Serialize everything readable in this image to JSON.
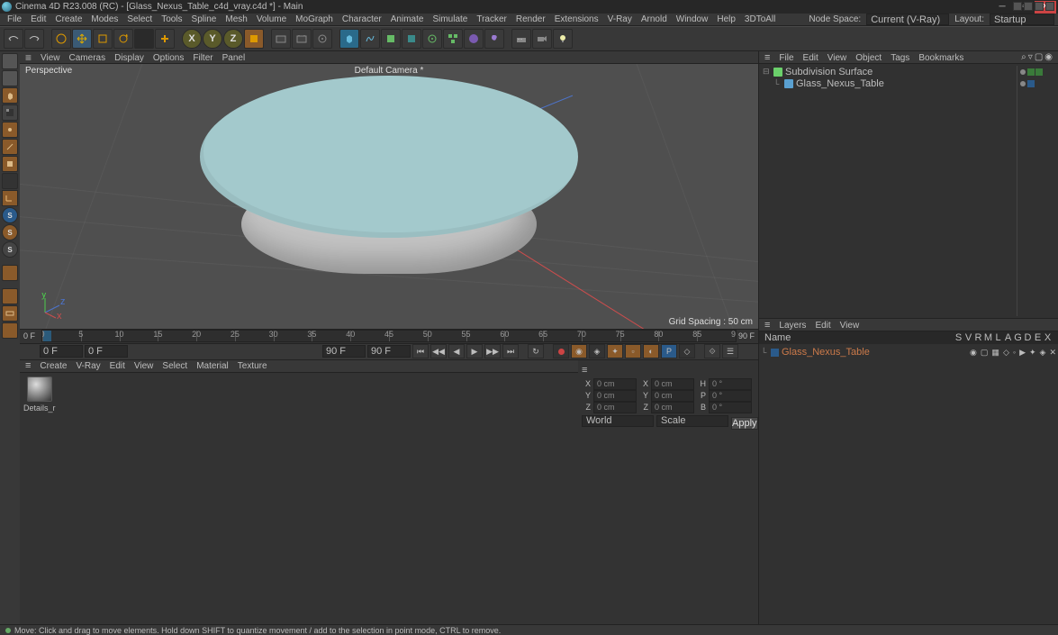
{
  "title": "Cinema 4D R23.008 (RC) - [Glass_Nexus_Table_c4d_vray.c4d *] - Main",
  "menubar": [
    "File",
    "Edit",
    "Create",
    "Modes",
    "Select",
    "Tools",
    "Spline",
    "Mesh",
    "Volume",
    "MoGraph",
    "Character",
    "Animate",
    "Simulate",
    "Tracker",
    "Render",
    "Extensions",
    "V-Ray",
    "Arnold",
    "Window",
    "Help",
    "3DToAll"
  ],
  "nodespace_lbl": "Node Space:",
  "nodespace_val": "Current (V-Ray)",
  "layout_lbl": "Layout:",
  "layout_val": "Startup",
  "view_menus": [
    "View",
    "Cameras",
    "Display",
    "Options",
    "Filter",
    "Panel"
  ],
  "viewport": {
    "name": "Perspective",
    "camera": "Default Camera *",
    "grid": "Grid Spacing : 50 cm"
  },
  "obj_menus": [
    "File",
    "Edit",
    "View",
    "Object",
    "Tags",
    "Bookmarks"
  ],
  "tree": [
    {
      "indent": 0,
      "icon": "#6bd06b",
      "name": "Subdivision Surface"
    },
    {
      "indent": 1,
      "icon": "#5aa0d0",
      "name": "Glass_Nexus_Table"
    }
  ],
  "layers_menus": [
    "Layers",
    "Edit",
    "View"
  ],
  "layers_cols": [
    "Name",
    "S",
    "V",
    "R",
    "M",
    "L",
    "A",
    "G",
    "D",
    "E",
    "X"
  ],
  "layer_row": {
    "name": "Glass_Nexus_Table"
  },
  "timeline": {
    "start": "0 F",
    "end": "90 F",
    "cur_start": "0 F",
    "cur_end": "90 F",
    "ticks": [
      0,
      5,
      10,
      15,
      20,
      25,
      30,
      35,
      40,
      45,
      50,
      55,
      60,
      65,
      70,
      75,
      80,
      85,
      90
    ]
  },
  "mat_menus": [
    "Create",
    "V-Ray",
    "Edit",
    "View",
    "Select",
    "Material",
    "Texture"
  ],
  "material": {
    "name": "Details_r"
  },
  "coords": {
    "rows": [
      {
        "a": "X",
        "av": "0 cm",
        "b": "X",
        "bv": "0 cm",
        "c": "H",
        "cv": "0 °"
      },
      {
        "a": "Y",
        "av": "0 cm",
        "b": "Y",
        "bv": "0 cm",
        "c": "P",
        "cv": "0 °"
      },
      {
        "a": "Z",
        "av": "0 cm",
        "b": "Z",
        "bv": "0 cm",
        "c": "B",
        "cv": "0 °"
      }
    ],
    "mode1": "World",
    "mode2": "Scale",
    "apply": "Apply"
  },
  "status": "Move: Click and drag to move elements. Hold down SHIFT to quantize movement / add to the selection in point mode, CTRL to remove.",
  "xyz": [
    "X",
    "Y",
    "Z"
  ]
}
